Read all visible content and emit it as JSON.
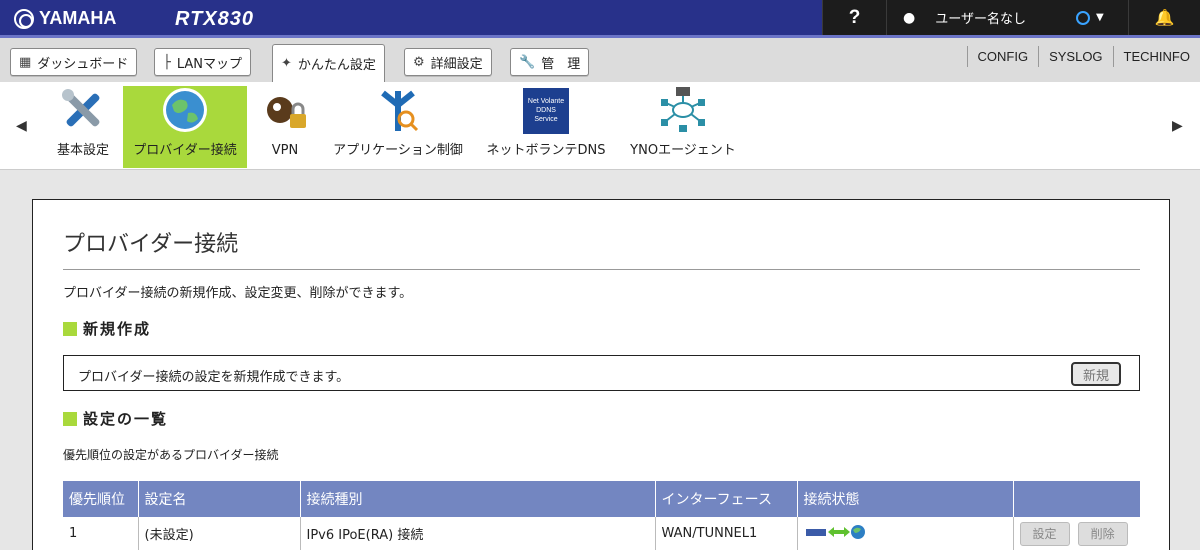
{
  "header": {
    "brand": "YAMAHA",
    "model": "RTX830",
    "help_label": "?",
    "user_label": "ユーザー名なし",
    "links": [
      "CONFIG",
      "SYSLOG",
      "TECHINFO"
    ]
  },
  "tabs": [
    {
      "label": "ダッシュボード",
      "icon": "dashboard-icon"
    },
    {
      "label": "LANマップ",
      "icon": "lan-map-icon"
    },
    {
      "label": "かんたん設定",
      "icon": "wand-icon",
      "active": true
    },
    {
      "label": "詳細設定",
      "icon": "gear-icon"
    },
    {
      "label": "管　理",
      "icon": "wrench-icon"
    }
  ],
  "submenu": [
    {
      "label": "基本設定",
      "icon": "tools-icon"
    },
    {
      "label": "プロバイダー接続",
      "icon": "globe-icon",
      "selected": true
    },
    {
      "label": "VPN",
      "icon": "vpn-keys-icon"
    },
    {
      "label": "アプリケーション制御",
      "icon": "app-control-icon"
    },
    {
      "label": "ネットボランテDNS",
      "icon": "ddns-icon",
      "badge_lines": [
        "Net Volante",
        "DDNS",
        "Service"
      ]
    },
    {
      "label": "YNOエージェント",
      "icon": "network-icon"
    }
  ],
  "page": {
    "title": "プロバイダー接続",
    "description": "プロバイダー接続の新規作成、設定変更、削除ができます。",
    "new_section": {
      "heading": "新規作成",
      "text": "プロバイダー接続の設定を新規作成できます。",
      "button": "新規"
    },
    "list_section": {
      "heading": "設定の一覧",
      "description": "優先順位の設定があるプロバイダー接続",
      "columns": [
        "優先順位",
        "設定名",
        "接続種別",
        "インターフェース",
        "接続状態",
        ""
      ],
      "rows": [
        {
          "priority": "1",
          "name": "(未設定)",
          "type": "IPv6 IPoE(RA) 接続",
          "interface": "WAN/TUNNEL1",
          "status_icon": "connected-status-icon",
          "edit": "設定",
          "delete": "削除"
        }
      ]
    }
  },
  "colors": {
    "topbar": "#28318a",
    "accent_green": "#a9d93c",
    "table_header": "#7386c1"
  }
}
